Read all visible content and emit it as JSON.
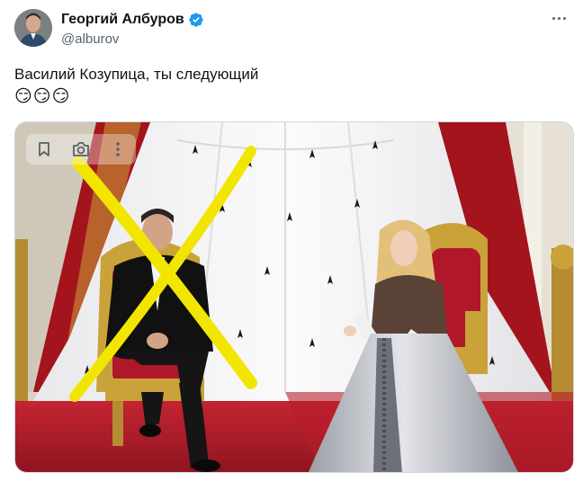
{
  "tweet": {
    "author": {
      "display_name": "Георгий Албуров",
      "handle": "@alburov",
      "verified": true,
      "avatar_icon": "avatar-photo"
    },
    "text": "Василий Козупица, ты следующий",
    "emojis": "😏😏😏",
    "menu_icon": "more-dots-icon",
    "media": {
      "overlay_actions": [
        "bookmark-icon",
        "camera-icon",
        "more-vertical-icon"
      ],
      "description_marks": {
        "cross_color": "#f2e600"
      }
    }
  },
  "colors": {
    "text": "#0f1419",
    "secondary": "#536471",
    "verified": "#1d9bf0",
    "curtain_red": "#a4141c",
    "carpet_red": "#b81e2a",
    "gold": "#c9a23a"
  }
}
